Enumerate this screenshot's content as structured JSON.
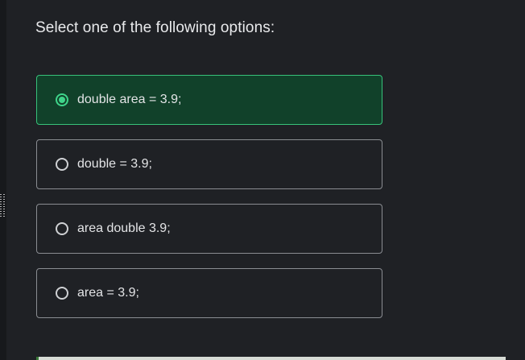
{
  "question": {
    "text": "Select one of the following options:"
  },
  "options": [
    {
      "label": "double area = 3.9;",
      "selected": true
    },
    {
      "label": "double = 3.9;",
      "selected": false
    },
    {
      "label": "area double 3.9;",
      "selected": false
    },
    {
      "label": "area = 3.9;",
      "selected": false
    }
  ],
  "colors": {
    "background": "#1f2125",
    "selected_fill": "#11412a",
    "selected_border": "#37c27a",
    "radio_selected": "#3fd48a",
    "option_border": "#8a8d92"
  }
}
